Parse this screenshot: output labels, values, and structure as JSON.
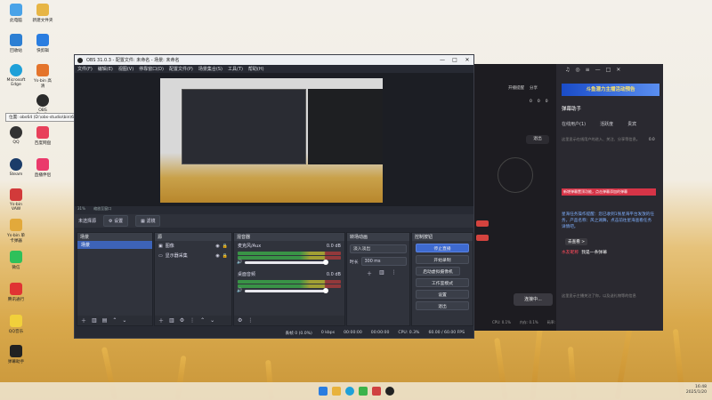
{
  "desktop": {
    "icons_col1": [
      "此电脑",
      "回收站",
      "Microsoft Edge",
      "QQ",
      "Steam",
      "Ys-bin VAW",
      "Ys-bin 单卡弹器",
      "微信",
      "腾讯通行",
      "QQ音乐",
      "弹幕助手"
    ],
    "icons_col2": [
      "新建文件夹",
      "快剪辑",
      "Ys-bin 高清",
      "OBS Studio",
      "百度网盘",
      "直播伴侣"
    ],
    "tooltip": "位置: obs64 (D:\\obs-studio\\bin\\64bit)"
  },
  "obs": {
    "title": "OBS 31.0.3 - 配置文件: 未命名 - 场景: 未命名",
    "menu": [
      "文件(F)",
      "编辑(E)",
      "视图(V)",
      "停靠窗口(D)",
      "配置文件(P)",
      "场景集合(S)",
      "工具(T)",
      "帮助(H)"
    ],
    "scale_label": "31%",
    "scale_sub": "缩放至窗口",
    "no_source": "未选择源",
    "properties_button": "设置",
    "filters_button": "滤镜",
    "scenes": {
      "title": "场景",
      "items": [
        "场景"
      ]
    },
    "sources": {
      "title": "源",
      "items": [
        "图像",
        "显示器采集"
      ]
    },
    "mixer": {
      "title": "混音器",
      "channels": [
        {
          "name": "麦克风/Aux",
          "db": "0.0 dB"
        },
        {
          "name": "桌面音频",
          "db": "0.0 dB"
        }
      ]
    },
    "transitions": {
      "title": "转场动画",
      "type": "淡入淡出",
      "duration_label": "时长",
      "duration": "300 ms"
    },
    "controls": {
      "title": "控制按钮",
      "buttons": [
        "停止直播",
        "开始录制",
        "启动虚拟摄像机",
        "工作室模式",
        "设置",
        "退出"
      ]
    },
    "status": {
      "frames": "丢帧 0 (0.0%)",
      "bitrate": "0 kbps",
      "live_time": "00:00:00",
      "rec_time": "00:00:00",
      "cpu": "CPU: 0.3%",
      "fps": "60.00 / 60.00 FPS"
    }
  },
  "liveapp": {
    "header_labels": [
      "开播提醒",
      "分享"
    ],
    "stats": [
      "0",
      "0",
      "0"
    ],
    "exit_button": "退出",
    "connect_button": "连接中...",
    "banner": "斗鱼潜力主播活动预告",
    "assistant_title": "弹幕助手",
    "tabs": [
      "在线用户(1)",
      "活跃度",
      "贵宾"
    ],
    "online_hint": "这里显示在线用户的进入、关注、分享等信息。",
    "tip_red": "新增弹幕置顶功能，点击弹幕添加的弹幕",
    "task_text": "星海任务操作提醒：您已收到1张星海平台发放的任务，产品名称：风之湖舞，点击前往星海查看任务详情吧。",
    "view_link": "去查看 >",
    "chat_user": "水友昵称",
    "chat_msg": "我是一条弹幕",
    "footer_hint": "这里显示主播关注了你，以及送礼物等的信息",
    "bottom_stats": [
      "CPU: 0.1%",
      "内存: 0.1%",
      "码率: 0K"
    ],
    "right_badge": "0.0"
  },
  "tray": {
    "time": "16:48",
    "date": "2025/1/20"
  }
}
